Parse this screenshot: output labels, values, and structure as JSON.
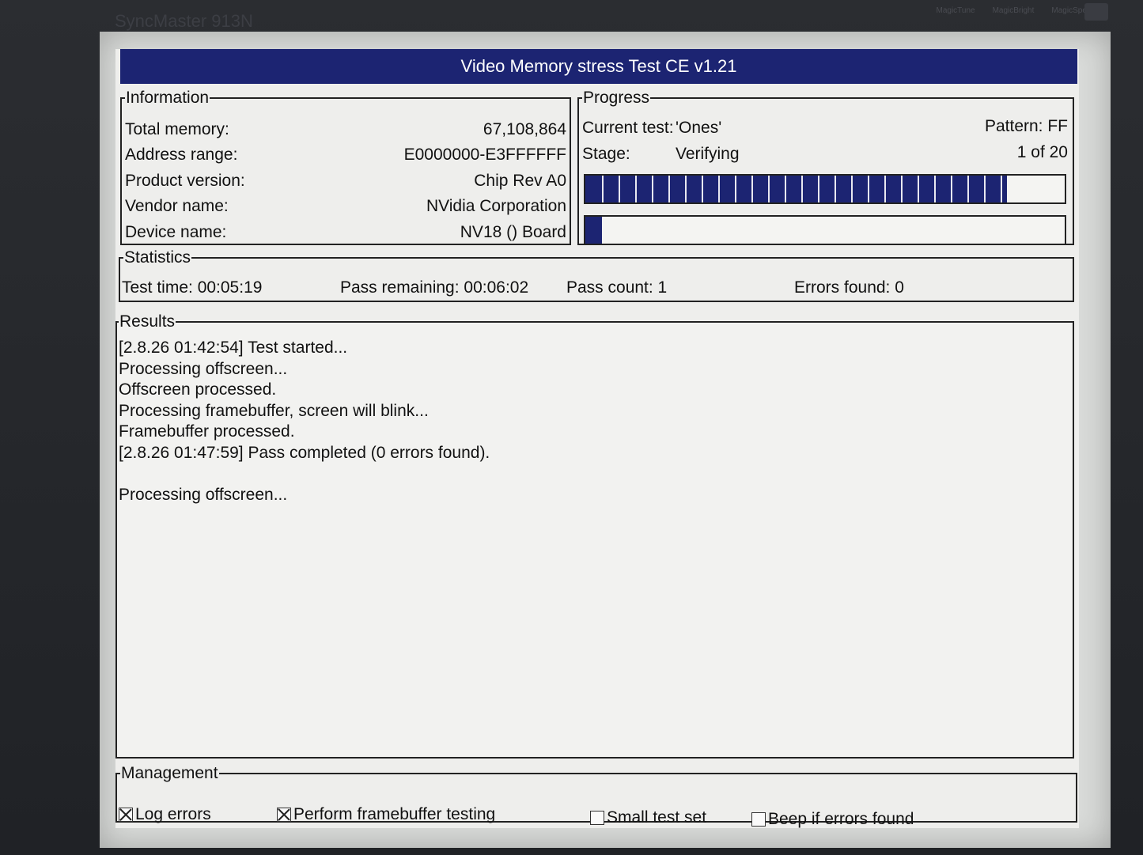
{
  "monitor": {
    "brand": "SyncMaster 913N",
    "logos": [
      "MagicTune",
      "MagicBright",
      "MagicSpeed"
    ]
  },
  "window": {
    "title": "Video Memory stress Test CE v1.21"
  },
  "information": {
    "legend": "Information",
    "rows": [
      {
        "label": "Total memory:",
        "value": "67,108,864"
      },
      {
        "label": "Address range:",
        "value": "E0000000-E3FFFFFF"
      },
      {
        "label": "Product version:",
        "value": "Chip Rev A0"
      },
      {
        "label": "Vendor name:",
        "value": "NVidia Corporation"
      },
      {
        "label": "Device name:",
        "value": "NV18 () Board"
      }
    ]
  },
  "progress": {
    "legend": "Progress",
    "current_test_label": "Current test:",
    "current_test_value": "'Ones'",
    "pattern": "Pattern: FF",
    "stage_label": "Stage:",
    "stage_value": "Verifying",
    "count": "1 of 20",
    "bar1_fraction": 0.88,
    "bar2_fraction": 0.035,
    "bar_color": "#1c2472"
  },
  "statistics": {
    "legend": "Statistics",
    "test_time": "Test time:  00:05:19",
    "pass_remaining": "Pass remaining:  00:06:02",
    "pass_count": "Pass count:  1",
    "errors_found": "Errors found:  0"
  },
  "results": {
    "legend": "Results",
    "lines": [
      "[2.8.26 01:42:54] Test started...",
      "Processing offscreen...",
      "Offscreen processed.",
      "Processing framebuffer, screen will blink...",
      "Framebuffer processed.",
      "[2.8.26 01:47:59] Pass completed (0 errors found).",
      "",
      "Processing offscreen..."
    ]
  },
  "management": {
    "legend": "Management",
    "options": [
      {
        "label": "Log errors",
        "checked": true
      },
      {
        "label": "Perform framebuffer testing",
        "checked": true
      },
      {
        "label": "Small test set",
        "checked": false
      },
      {
        "label": "Beep if errors found",
        "checked": false
      }
    ]
  }
}
